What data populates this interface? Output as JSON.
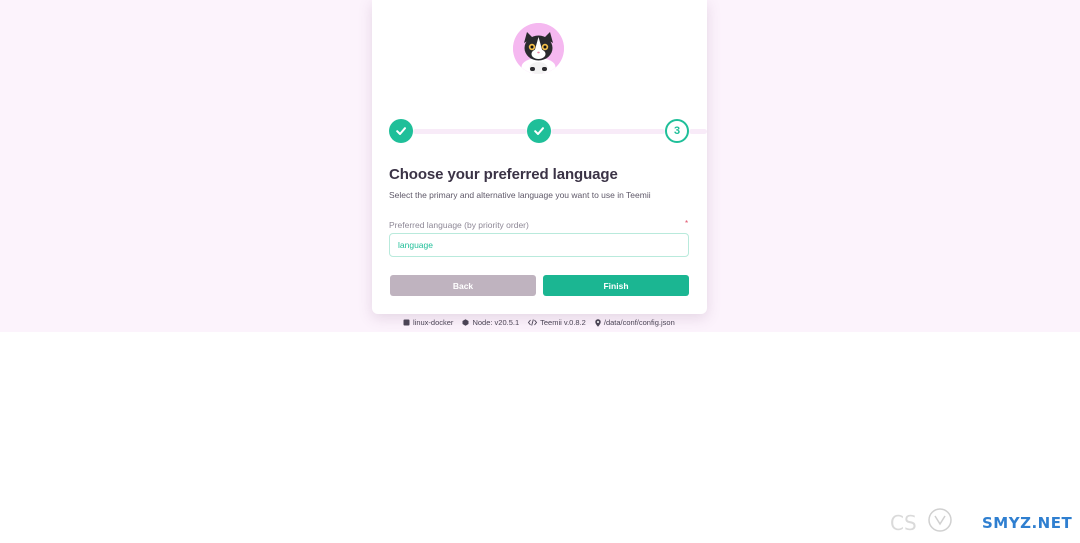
{
  "steps": [
    {
      "state": "done",
      "icon": "check-icon"
    },
    {
      "state": "done",
      "icon": "check-icon"
    },
    {
      "state": "active",
      "number": "3"
    }
  ],
  "form": {
    "title": "Choose your preferred language",
    "subtitle": "Select the primary and alternative language you want to use in Teemii",
    "field_label": "Preferred language (by priority order)",
    "required_mark": "*",
    "input_placeholder": "language",
    "input_value": ""
  },
  "buttons": {
    "back_label": "Back",
    "finish_label": "Finish"
  },
  "footer": {
    "host": "linux-docker",
    "node": "Node: v20.5.1",
    "version": "Teemii v.0.8.2",
    "config_path": "/data/conf/config.json"
  },
  "watermark": {
    "text": "SMYZ.NET"
  },
  "colors": {
    "accent": "#1bb692",
    "background": "#fcf3fc",
    "back_button": "#bfb3bf",
    "title": "#3b3346"
  }
}
